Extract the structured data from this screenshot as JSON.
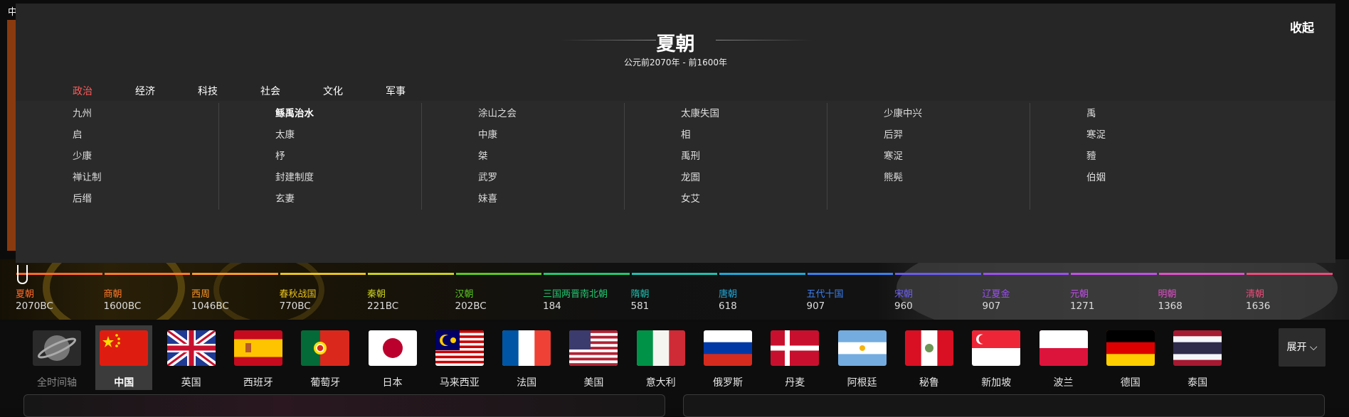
{
  "background": {
    "corner_text": "中"
  },
  "panel": {
    "collapse_label": "收起",
    "title": "夏朝",
    "period": "公元前2070年 - 前1600年",
    "tabs": [
      "政治",
      "经济",
      "科技",
      "社会",
      "文化",
      "军事"
    ],
    "active_tab": "政治",
    "event_columns": [
      [
        "九州",
        "启",
        "少康",
        "禅让制",
        "后缗"
      ],
      [
        "鲧禹治水",
        "太康",
        "杼",
        "封建制度",
        "玄妻"
      ],
      [
        "涂山之会",
        "中康",
        "桀",
        "武罗",
        "妹喜"
      ],
      [
        "太康失国",
        "相",
        "禹刑",
        "龙圄",
        "女艾"
      ],
      [
        "少康中兴",
        "后羿",
        "寒浞",
        "熊髡"
      ],
      [
        "禹",
        "寒浞",
        "豷",
        "伯姻"
      ]
    ],
    "bold_event": "鲧禹治水"
  },
  "timeline": [
    {
      "name": "夏朝",
      "year": "2070BC",
      "color": "#ff6a2a"
    },
    {
      "name": "商朝",
      "year": "1600BC",
      "color": "#ff7a2a"
    },
    {
      "name": "西周",
      "year": "1046BC",
      "color": "#ff9a2a"
    },
    {
      "name": "春秋战国",
      "year": "770BC",
      "color": "#e8c21f"
    },
    {
      "name": "秦朝",
      "year": "221BC",
      "color": "#c9d11f"
    },
    {
      "name": "汉朝",
      "year": "202BC",
      "color": "#5ac81f"
    },
    {
      "name": "三国两晋南北朝",
      "year": "184",
      "color": "#22c870"
    },
    {
      "name": "隋朝",
      "year": "581",
      "color": "#1fc0b0"
    },
    {
      "name": "唐朝",
      "year": "618",
      "color": "#1fa8d8"
    },
    {
      "name": "五代十国",
      "year": "907",
      "color": "#3a7ff0"
    },
    {
      "name": "宋朝",
      "year": "960",
      "color": "#6a5cf0"
    },
    {
      "name": "辽夏金",
      "year": "907",
      "color": "#9a4ff0"
    },
    {
      "name": "元朝",
      "year": "1271",
      "color": "#c04fe8"
    },
    {
      "name": "明朝",
      "year": "1368",
      "color": "#e04fc8"
    },
    {
      "name": "清朝",
      "year": "1636",
      "color": "#f04a7a"
    }
  ],
  "countries": [
    {
      "name": "全时间轴",
      "flag": "globe-icon"
    },
    {
      "name": "中国",
      "flag": "china"
    },
    {
      "name": "英国",
      "flag": "uk"
    },
    {
      "name": "西班牙",
      "flag": "spain"
    },
    {
      "name": "葡萄牙",
      "flag": "portugal"
    },
    {
      "name": "日本",
      "flag": "japan"
    },
    {
      "name": "马来西亚",
      "flag": "malaysia"
    },
    {
      "name": "法国",
      "flag": "france"
    },
    {
      "name": "美国",
      "flag": "usa"
    },
    {
      "name": "意大利",
      "flag": "italy"
    },
    {
      "name": "俄罗斯",
      "flag": "russia"
    },
    {
      "name": "丹麦",
      "flag": "denmark"
    },
    {
      "name": "阿根廷",
      "flag": "argentina"
    },
    {
      "name": "秘鲁",
      "flag": "peru"
    },
    {
      "name": "新加坡",
      "flag": "singapore"
    },
    {
      "name": "波兰",
      "flag": "poland"
    },
    {
      "name": "德国",
      "flag": "germany"
    },
    {
      "name": "泰国",
      "flag": "thailand"
    }
  ],
  "selected_country": "中国",
  "expand_label": "展开",
  "colors": {
    "active_tab": "#ff5a5a",
    "panel_bg": "#2a2a2a"
  }
}
